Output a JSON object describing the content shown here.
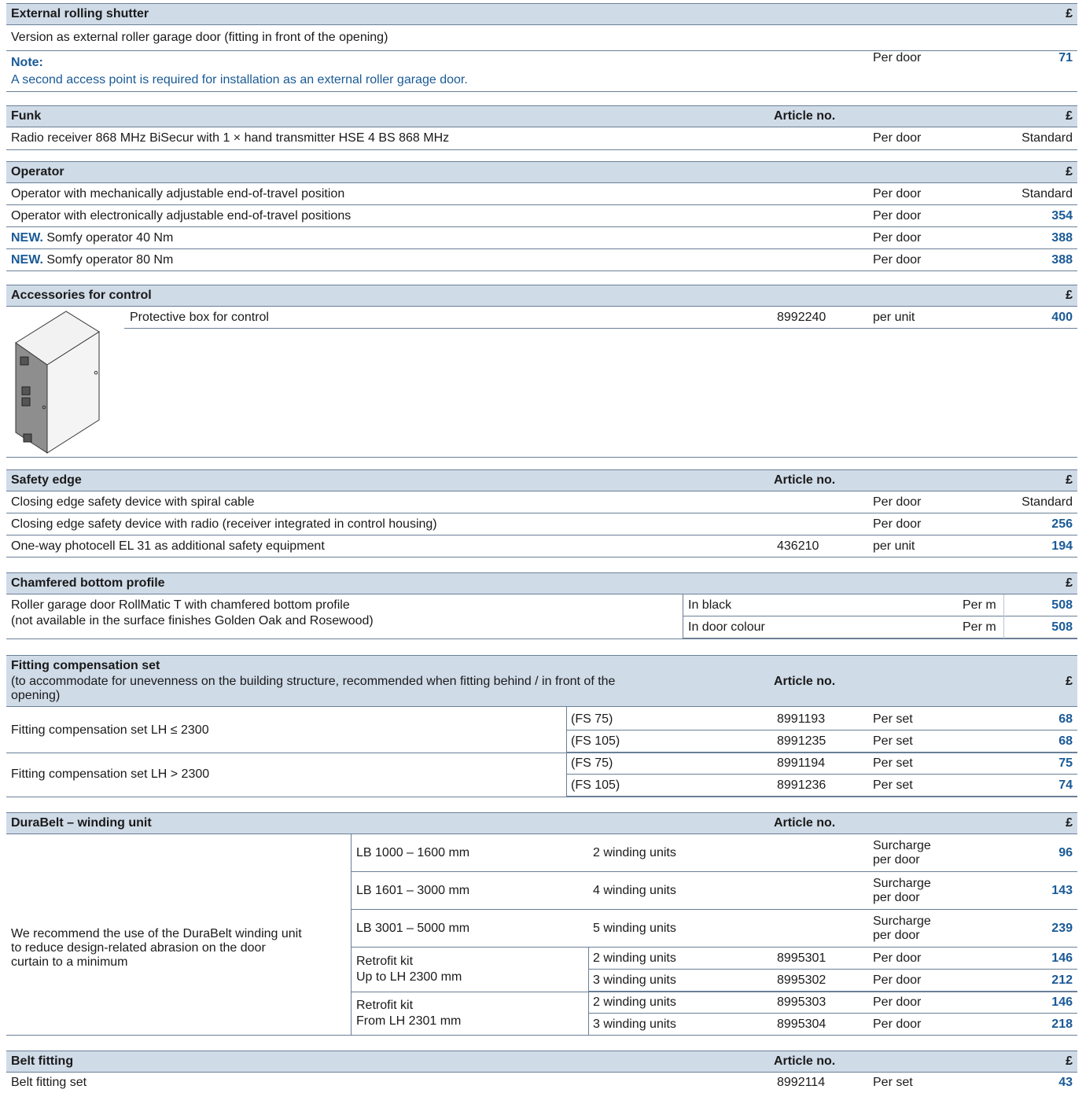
{
  "currency_symbol": "£",
  "article_no_label": "Article no.",
  "external_rolling_shutter": {
    "title": "External rolling shutter",
    "version_text": "Version as external roller garage door (fitting in front of the opening)",
    "note_label": "Note:",
    "note_text": "A second access point is required for installation as an external roller garage door.",
    "unit": "Per door",
    "price": "71"
  },
  "funk": {
    "title": "Funk",
    "row_label": "Radio receiver 868 MHz BiSecur with 1 × hand transmitter HSE 4 BS 868 MHz",
    "unit": "Per door",
    "price": "Standard"
  },
  "operator": {
    "title": "Operator",
    "new_label": "NEW.",
    "rows": [
      {
        "label": "Operator with mechanically adjustable end-of-travel position",
        "unit": "Per door",
        "price": "Standard"
      },
      {
        "label": "Operator with electronically adjustable end-of-travel positions",
        "unit": "Per door",
        "price": "354"
      },
      {
        "label": "Somfy operator 40 Nm",
        "unit": "Per door",
        "price": "388"
      },
      {
        "label": "Somfy operator 80 Nm",
        "unit": "Per door",
        "price": "388"
      }
    ]
  },
  "accessories": {
    "title": "Accessories for control",
    "label": "Protective box for control",
    "article": "8992240",
    "unit": "per unit",
    "price": "400"
  },
  "safety_edge": {
    "title": "Safety edge",
    "rows": [
      {
        "label": "Closing edge safety device with spiral cable",
        "article": "",
        "unit": "Per door",
        "price": "Standard"
      },
      {
        "label": "Closing edge safety device with radio (receiver integrated in control housing)",
        "article": "",
        "unit": "Per door",
        "price": "256"
      },
      {
        "label": "One-way photocell EL 31 as additional safety equipment",
        "article": "436210",
        "unit": "per unit",
        "price": "194"
      }
    ]
  },
  "chamfered": {
    "title": "Chamfered bottom profile",
    "label_line1": "Roller garage door RollMatic T with chamfered bottom profile",
    "label_line2": "(not available in the surface finishes Golden Oak and Rosewood)",
    "options": [
      {
        "label": "In black",
        "unit": "Per m",
        "price": "508"
      },
      {
        "label": "In door colour",
        "unit": "Per m",
        "price": "508"
      }
    ]
  },
  "fitting_comp": {
    "title": "Fitting compensation set",
    "subtitle_line1": "(to accommodate for unevenness on the building structure, recommended when fitting behind / in front of the",
    "subtitle_line2": "opening)",
    "groups": [
      {
        "label": "Fitting compensation set LH ≤ 2300",
        "rows": [
          {
            "type": "(FS 75)",
            "article": "8991193",
            "unit": "Per set",
            "price": "68"
          },
          {
            "type": "(FS 105)",
            "article": "8991235",
            "unit": "Per set",
            "price": "68"
          }
        ]
      },
      {
        "label": "Fitting compensation set LH > 2300",
        "rows": [
          {
            "type": "(FS 75)",
            "article": "8991194",
            "unit": "Per set",
            "price": "75"
          },
          {
            "type": "(FS 105)",
            "article": "8991236",
            "unit": "Per set",
            "price": "74"
          }
        ]
      }
    ]
  },
  "durabelt": {
    "title": "DuraBelt – winding unit",
    "recommend_line1": "We recommend the use of the DuraBelt winding unit",
    "recommend_line2": "to reduce design-related abrasion on the door",
    "recommend_line3": "curtain to a minimum",
    "surcharge_line1": "Surcharge",
    "surcharge_line2": "per door",
    "width_rows": [
      {
        "range": "LB 1000 – 1600 mm",
        "units": "2 winding units",
        "price": "96"
      },
      {
        "range": "LB 1601 – 3000 mm",
        "units": "4 winding units",
        "price": "143"
      },
      {
        "range": "LB 3001 – 5000 mm",
        "units": "5 winding units",
        "price": "239"
      }
    ],
    "retrofit_groups": [
      {
        "line1": "Retrofit kit",
        "line2": "Up to LH 2300 mm",
        "rows": [
          {
            "units": "2 winding units",
            "article": "8995301",
            "unit": "Per door",
            "price": "146"
          },
          {
            "units": "3 winding units",
            "article": "8995302",
            "unit": "Per door",
            "price": "212"
          }
        ]
      },
      {
        "line1": "Retrofit kit",
        "line2": "From LH 2301 mm",
        "rows": [
          {
            "units": "2 winding units",
            "article": "8995303",
            "unit": "Per door",
            "price": "146"
          },
          {
            "units": "3 winding units",
            "article": "8995304",
            "unit": "Per door",
            "price": "218"
          }
        ]
      }
    ]
  },
  "belt_fitting": {
    "title": "Belt fitting",
    "label": "Belt fitting set",
    "article": "8992114",
    "unit": "Per set",
    "price": "43"
  },
  "colors": {
    "header_bg": "#d0dbe8",
    "rule": "#6a7f97",
    "price_blue": "#1a5a96"
  }
}
